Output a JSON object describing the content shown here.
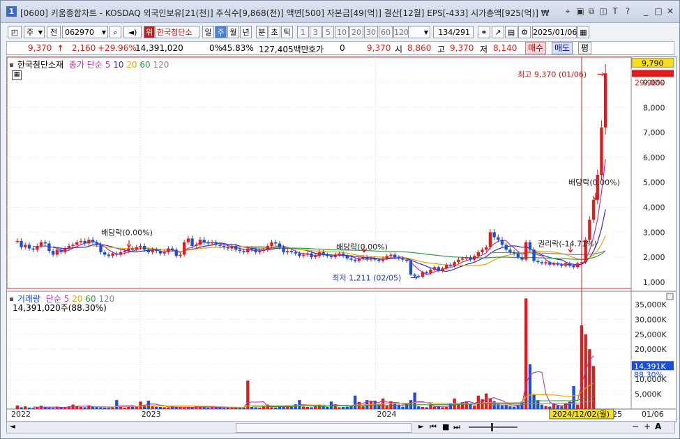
{
  "titlebar": {
    "window_number": "1",
    "title": "[0600] 키움종합차트 - KOSDAQ 외국인보유[21(천)] 주식수[9,868(천)] 액면[500] 자본금[49(억)] 결산[12월] EPS[-433] 시가총액[925(억)] ₩"
  },
  "toolbar": {
    "period_mode": "주",
    "jeon": "전",
    "code": "062970",
    "stock_badge": "위",
    "stock_name": "한국첨단소",
    "periods": [
      "일",
      "주",
      "월",
      "년",
      "분",
      "초",
      "틱"
    ],
    "selected_period": "주",
    "minute_steps": [
      "1",
      "3",
      "5",
      "10",
      "20",
      "30",
      "60",
      "120"
    ],
    "page_count": "134",
    "page_total": "/291",
    "date": "2025/01/06"
  },
  "infobar": {
    "price": "9,370",
    "change": "2,160",
    "change_pct": "+29.96%",
    "volume": "14,391,020",
    "turnover_label": "0%",
    "turnover_pct": "45.83%",
    "amount": "127,405백만",
    "quote_label": "호가",
    "quote_value": "0",
    "quote_price": "9,370",
    "open_label": "시",
    "open_value": "8,860",
    "high_label": "고",
    "high_value": "9,370",
    "low_label": "저",
    "low_value": "8,140",
    "buy_label": "매수",
    "sell_label": "매도",
    "avg_label": "평"
  },
  "colors": {
    "up": "#e21b1b",
    "down": "#1c4fd6",
    "ma5": "#b232b2",
    "ma10": "#2b2bd6",
    "ma20": "#e8a400",
    "ma60": "#2e9a3e",
    "ma120": "#888888"
  },
  "price_panel": {
    "legend_name": "한국첨단소재",
    "legend_ma": "종가 단순",
    "legend_periods": [
      "5",
      "10",
      "20",
      "60",
      "120"
    ],
    "price_axis_labels": [
      "9,000",
      "8,000",
      "7,000",
      "6,000",
      "5,000",
      "4,000",
      "3,000",
      "2,000",
      "1,000"
    ],
    "current_price_tag": "9,790",
    "change_tag": "29.96%",
    "annotations": {
      "high": "최고 9,370 (01/06)",
      "low": "최저 1,211 (02/05)",
      "dividend1": "배당락(0.00%)",
      "dividend2": "배당락(0.00%)",
      "dividend3": "배당락(0.00%)",
      "rights": "권리락(-14.71%)"
    }
  },
  "volume_panel": {
    "legend_name": "거래량",
    "legend_ma": "단순",
    "legend_periods": [
      "5",
      "20",
      "60",
      "120"
    ],
    "current_volume": "14,391,020주(88.30%)",
    "axis_labels": [
      "35,000K",
      "30,000K",
      "25,000K",
      "20,000K",
      "15,000K",
      "10,000K",
      "5,000K"
    ],
    "current_tag": "14,391K",
    "pct_tag": "88.30%"
  },
  "xaxis": {
    "labels": [
      "2022",
      "2023",
      "2024"
    ],
    "cursor_date": "2024/12/02(월)",
    "right_label": "01/06",
    "partial_label": "25"
  },
  "chart_data": {
    "type": "candlestick",
    "period": "weekly",
    "x_labels": [
      "2022",
      "2023",
      "2024",
      "25"
    ],
    "ylim": [
      800,
      9800
    ],
    "volume_ylim": [
      0,
      38000
    ],
    "volume_unit": "K",
    "weeks_shown": 134,
    "closes": [
      2650,
      2400,
      2500,
      2350,
      2300,
      2450,
      2600,
      2550,
      2250,
      2100,
      2300,
      2200,
      2350,
      2450,
      2500,
      2600,
      2650,
      2550,
      2700,
      2600,
      2500,
      2200,
      2100,
      2050,
      2150,
      2100,
      2200,
      2250,
      2350,
      2300,
      2400,
      2450,
      2300,
      2200,
      2300,
      2250,
      2150,
      2200,
      2350,
      2300,
      2050,
      2100,
      2600,
      2750,
      2450,
      2500,
      2700,
      2600,
      2550,
      2600,
      2500,
      2450,
      2400,
      2350,
      2450,
      2300,
      2250,
      2200,
      2350,
      2300,
      2200,
      2250,
      2300,
      2450,
      2600,
      2550,
      2400,
      2200,
      2250,
      2200,
      2150,
      2050,
      2100,
      2150,
      2000,
      2050,
      2200,
      2100,
      2050,
      2000,
      2100,
      2150,
      2050,
      1950,
      1900,
      1850,
      1950,
      2000,
      1900,
      1950,
      1900,
      1850,
      1950,
      2050,
      2100,
      2000,
      1950,
      1900,
      1850,
      1300,
      1250,
      1211,
      1400,
      1350,
      1500,
      1600,
      1450,
      1550,
      1700,
      1650,
      1800,
      1900,
      1950,
      2000,
      1900,
      2050,
      2200,
      2300,
      2400,
      3000,
      2800,
      2700,
      2500,
      2300,
      2200,
      2150,
      2000,
      1900,
      2600,
      2300,
      1850,
      1800,
      1750,
      1800,
      1700,
      1750,
      1700,
      1650,
      1750,
      1650,
      1600,
      1750,
      1800,
      2700,
      3500,
      4300,
      5300,
      7200,
      9370
    ],
    "volumes": [
      1200,
      600,
      900,
      500,
      400,
      700,
      1100,
      600,
      500,
      400,
      800,
      600,
      700,
      900,
      1500,
      1000,
      700,
      600,
      1200,
      800,
      900,
      600,
      500,
      400,
      500,
      3000,
      700,
      500,
      800,
      900,
      1000,
      2500,
      1200,
      2800,
      900,
      800,
      700,
      600,
      500,
      900,
      700,
      600,
      500,
      600,
      500,
      1100,
      800,
      600,
      500,
      700,
      600,
      500,
      400,
      700,
      600,
      500,
      400,
      500,
      9500,
      700,
      600,
      500,
      800,
      1500,
      600,
      500,
      900,
      700,
      1200,
      800,
      1600,
      3000,
      800,
      700,
      600,
      900,
      1500,
      800,
      700,
      2500,
      1600,
      600,
      700,
      800,
      1200,
      4500,
      2400,
      900,
      3000,
      2600,
      2800,
      1800,
      3500,
      1000,
      2600,
      2000,
      1500,
      800,
      2000,
      3000,
      5500,
      900,
      700,
      600,
      1500,
      800,
      900,
      600,
      700,
      2000,
      3500,
      1900,
      2300,
      2600,
      1700,
      1200,
      4500,
      3300,
      5200,
      3400,
      2600,
      1800,
      1200,
      1500,
      900,
      800,
      1500,
      2500,
      37000,
      15000,
      5000,
      3000,
      1500,
      1000,
      800,
      2000,
      1200,
      900,
      1800,
      2500,
      7700,
      1500,
      28000,
      25000,
      20000,
      14391
    ]
  }
}
